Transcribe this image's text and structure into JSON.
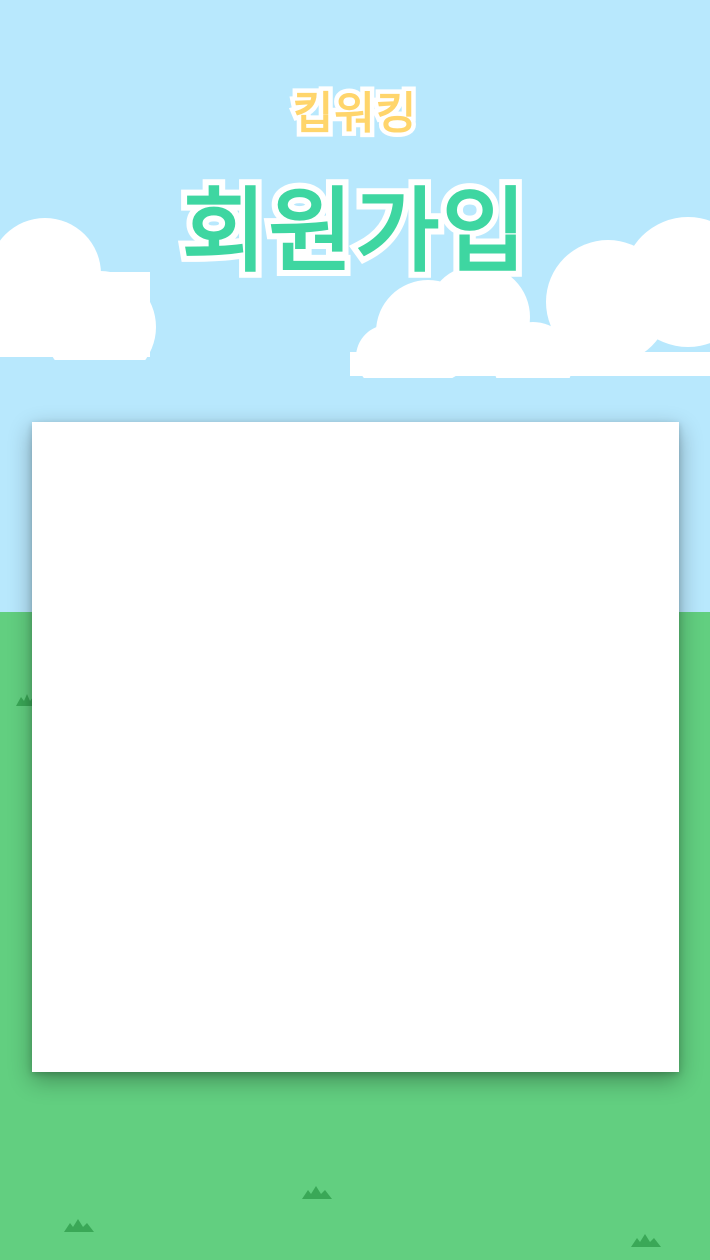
{
  "header": {
    "brand": "킵워킹",
    "title": "회원가입"
  },
  "colors": {
    "sky": "#b8e8fd",
    "ground": "#62cf80",
    "grass_tuft": "#3aa857",
    "cloud": "#ffffff",
    "brand_text": "#ffd56b",
    "title_text": "#3ed6a1",
    "card": "#ffffff"
  },
  "decor": {
    "cloud_icon": "cloud-icon",
    "grass_icon": "grass-tuft-icon"
  }
}
